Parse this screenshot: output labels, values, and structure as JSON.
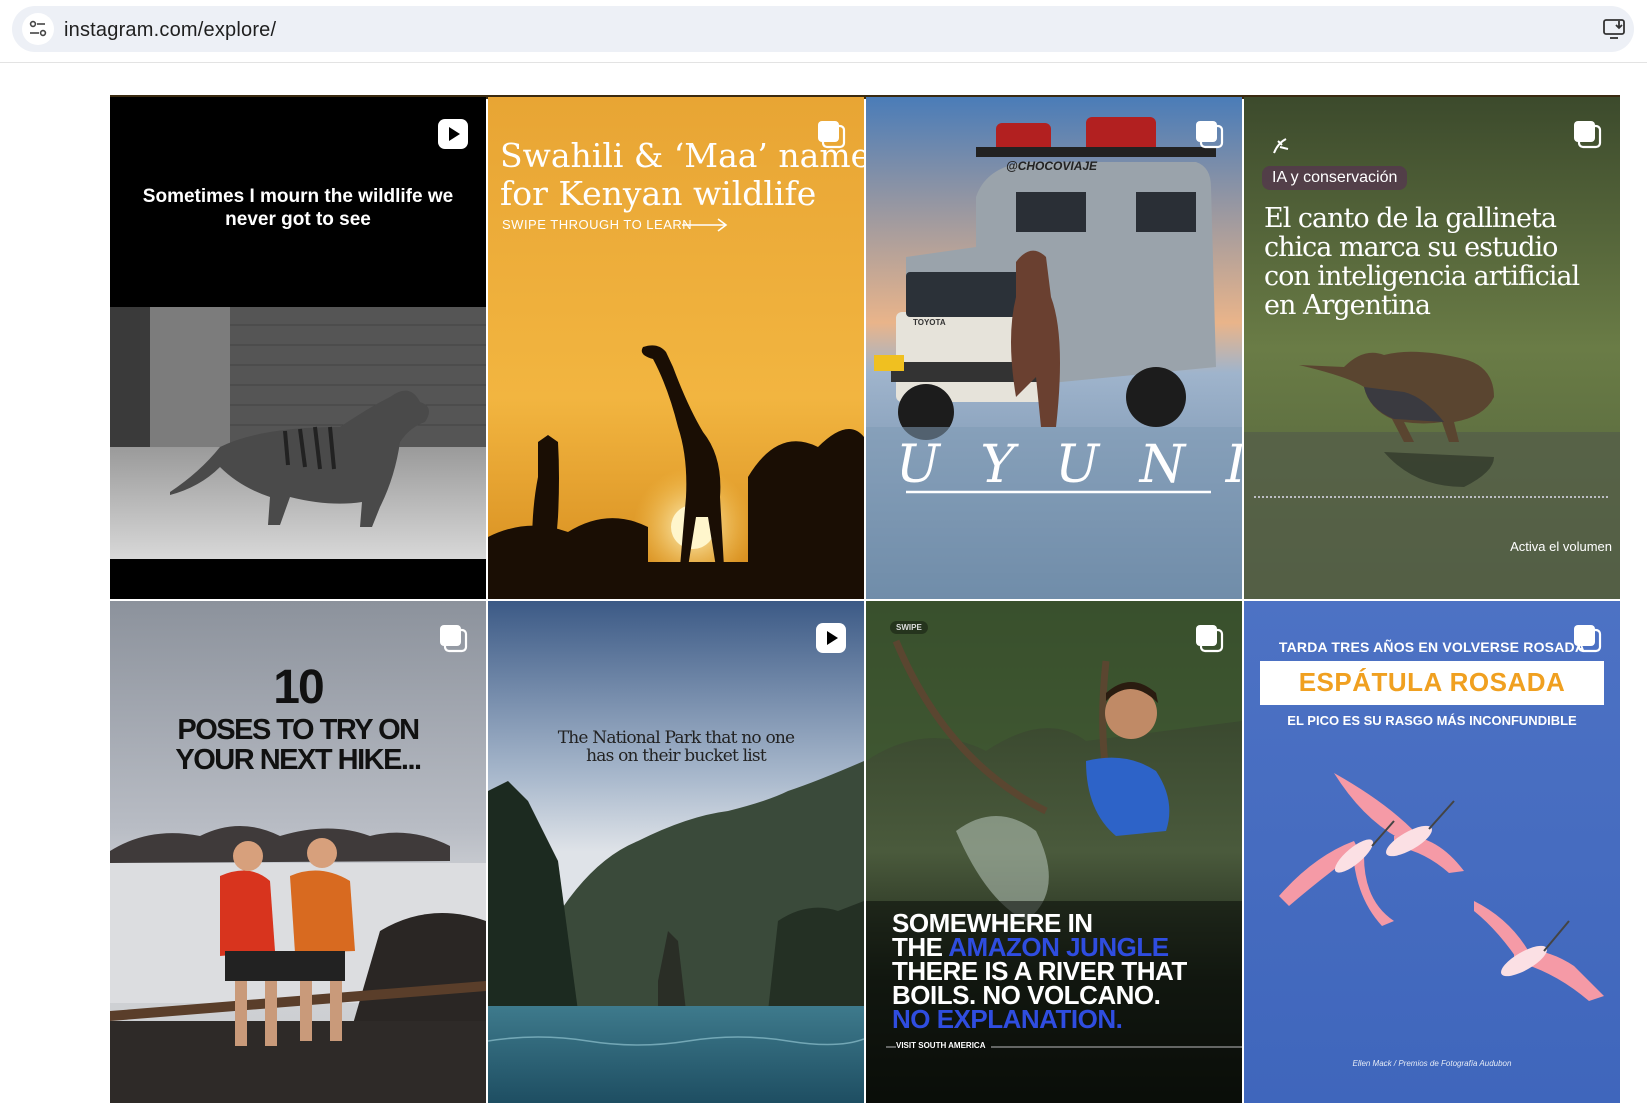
{
  "browser": {
    "url": "instagram.com/explore/"
  },
  "posts": [
    {
      "type": "reel",
      "icon": "reel-icon",
      "headline": "Sometimes I mourn the wildlife we never got to see"
    },
    {
      "type": "carousel",
      "icon": "carousel-icon",
      "headline_line1": "Swahili & ‘Maa’ names",
      "headline_line2": "for Kenyan wildlife",
      "sub": "SWIPE THROUGH TO LEARN"
    },
    {
      "type": "carousel",
      "icon": "carousel-icon",
      "plate": "@CHOCOVIAJE",
      "brand": "TOYOTA",
      "title": "U Y U N I"
    },
    {
      "type": "carousel",
      "icon": "carousel-icon",
      "tag": "IA y conservación",
      "headline_lines": [
        "El canto de la gallineta",
        "chica marca su estudio",
        "con inteligencia artificial",
        "en Argentina"
      ],
      "footer": "Activa el volumen"
    },
    {
      "type": "carousel",
      "icon": "carousel-icon",
      "number": "10",
      "line1": "POSES TO TRY ON",
      "line2": "YOUR NEXT HIKE..."
    },
    {
      "type": "reel",
      "icon": "reel-icon",
      "line1": "The National Park that no one",
      "line2": "has on their bucket list"
    },
    {
      "type": "carousel",
      "icon": "carousel-icon",
      "swipe": "SWIPE",
      "lines": [
        "SOMEWHERE IN"
      ],
      "the": "THE ",
      "highlight1": "AMAZON JUNGLE",
      "line3": "THERE IS A RIVER THAT",
      "line4": "BOILS. NO VOLCANO.",
      "highlight2": "NO EXPLANATION.",
      "footer": "VISIT SOUTH AMERICA"
    },
    {
      "type": "carousel",
      "icon": "carousel-icon",
      "top": "TARDA TRES AÑOS EN VOLVERSE ROSADA",
      "title": "ESPÁTULA ROSADA",
      "sub": "EL PICO ES SU RASGO MÁS INCONFUNDIBLE",
      "credit": "Ellen Mack / Premios de Fotografía Audubon"
    }
  ],
  "colors": {
    "accent_blue": "#2f4de0",
    "title_orange": "#f0a020",
    "pink": "#f59aa6"
  }
}
